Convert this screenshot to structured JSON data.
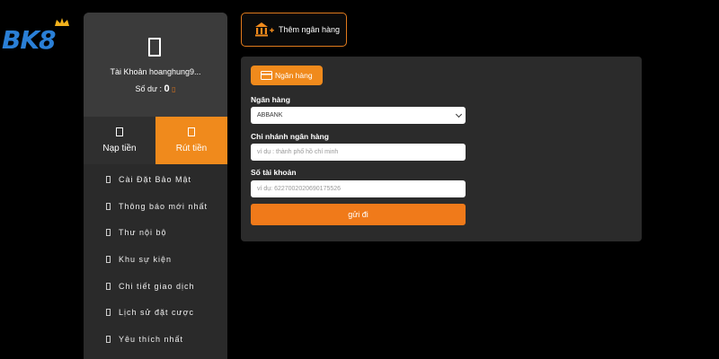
{
  "logo": {
    "text": "BK8"
  },
  "profile": {
    "account_label": "Tài Khoản hoanghung9...",
    "balance_label": "Số dư :",
    "balance_value": "0",
    "coin_icon": "coin-icon"
  },
  "actions": {
    "deposit_label": "Nạp tiền",
    "withdraw_label": "Rút tiền"
  },
  "menu": [
    {
      "label": "Cài Đặt Bảo Mật"
    },
    {
      "label": "Thông báo mới nhất"
    },
    {
      "label": "Thư nội bộ"
    },
    {
      "label": "Khu sự kiện"
    },
    {
      "label": "Chi tiết giao dịch"
    },
    {
      "label": "Lịch sử đặt cược"
    },
    {
      "label": "Yêu thích nhất"
    }
  ],
  "add_bank_button": {
    "label": "Thêm ngân hàng",
    "icon": "bank-add-icon"
  },
  "form": {
    "chip_label": "Ngân hàng",
    "bank_label": "Ngân hàng",
    "bank_value": "ABBANK",
    "branch_label": "Chi nhánh ngân hàng",
    "branch_placeholder": "ví dụ : thành phố hồ chí minh",
    "account_label": "Số tài khoản",
    "account_placeholder": "ví dụ: 6227002020690175526",
    "submit_label": "gửi đi"
  },
  "colors": {
    "accent": "#f08a1c",
    "sidebar_bg": "#2a2a2a",
    "panel_bg": "#2b2b2b",
    "logo_blue": "#2a7fd6"
  }
}
